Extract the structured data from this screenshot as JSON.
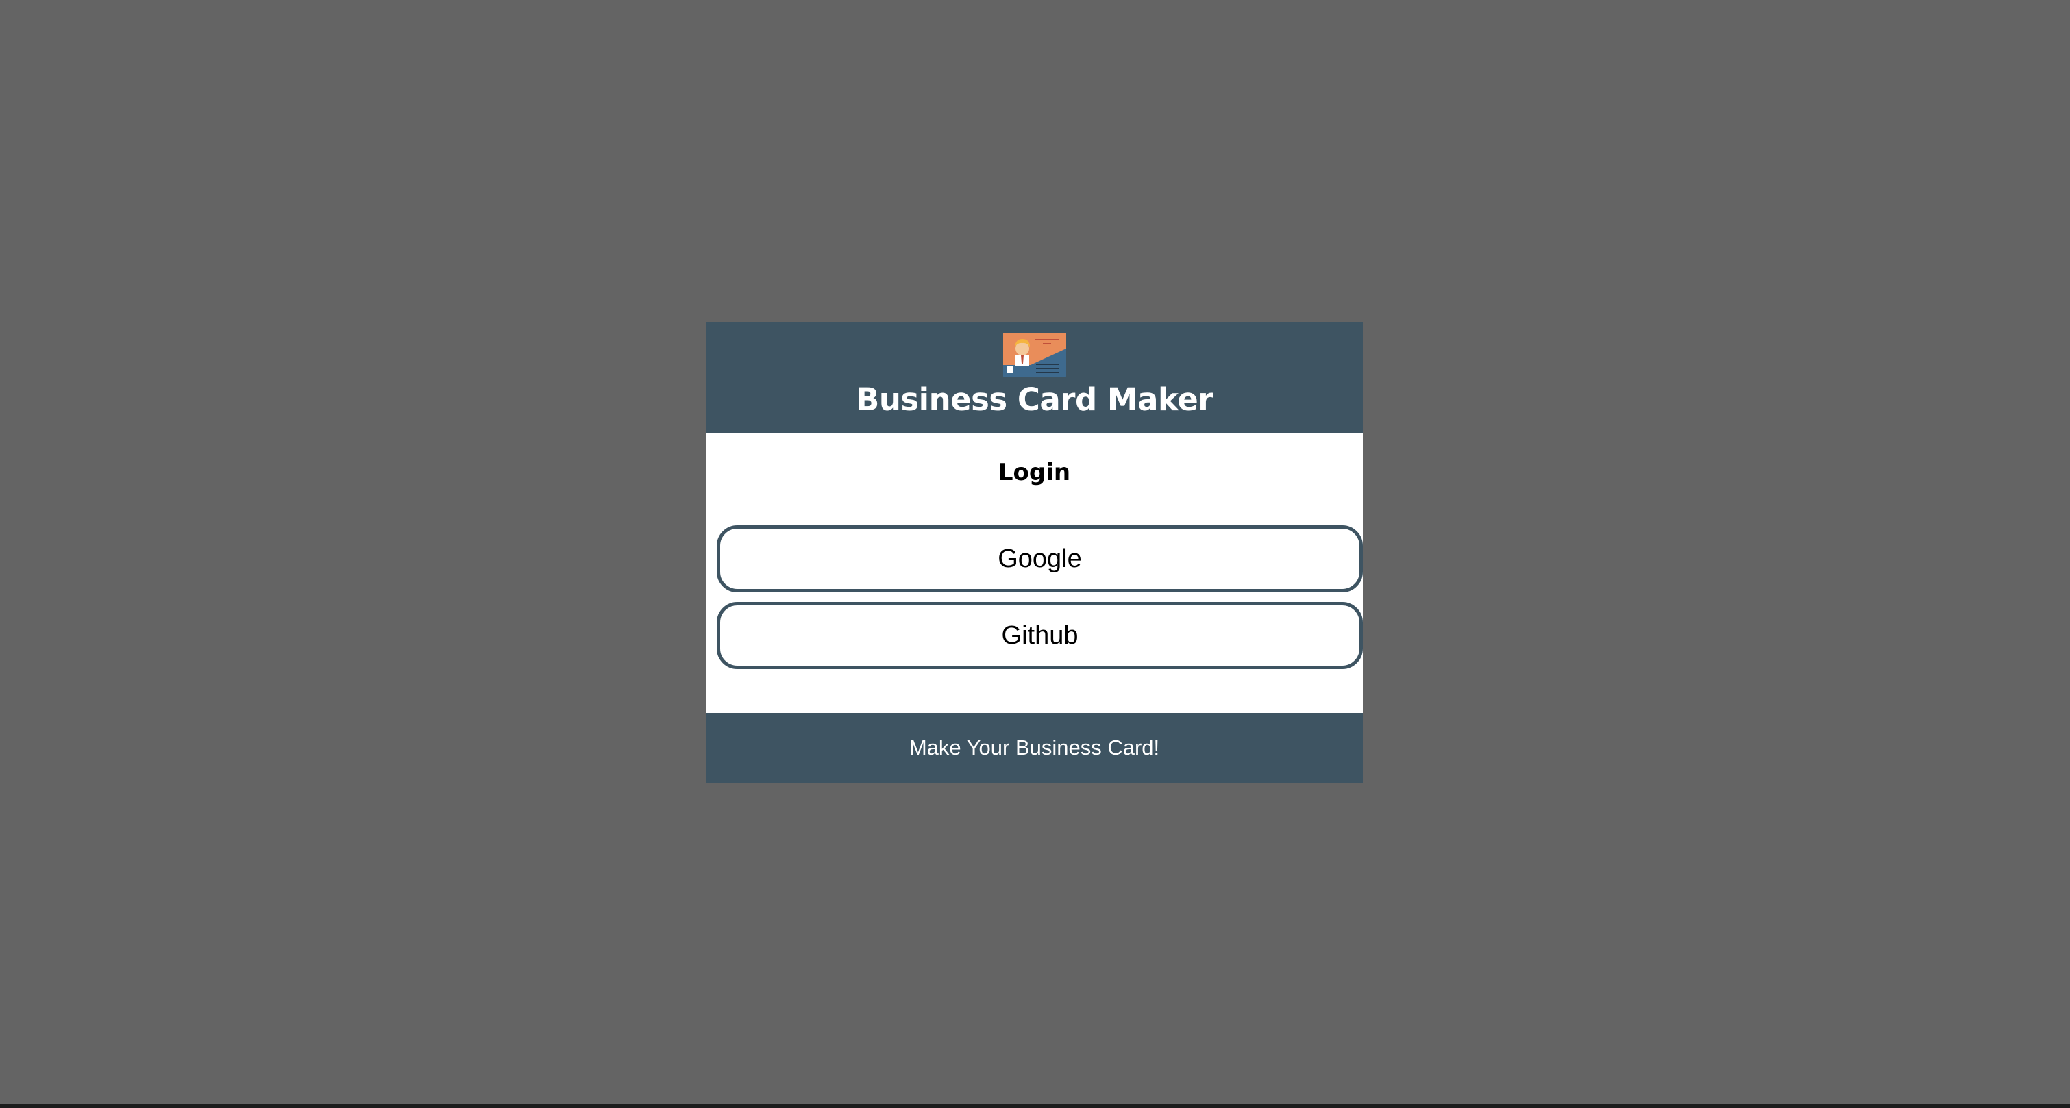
{
  "header": {
    "logo_icon": "business-card-icon",
    "title": "Business Card Maker"
  },
  "main": {
    "heading": "Login",
    "buttons": [
      {
        "label": "Google"
      },
      {
        "label": "Github"
      }
    ]
  },
  "footer": {
    "text": "Make Your Business Card!"
  },
  "colors": {
    "backdrop": "#646464",
    "brand": "#3e5462",
    "card_bg": "#ffffff"
  }
}
